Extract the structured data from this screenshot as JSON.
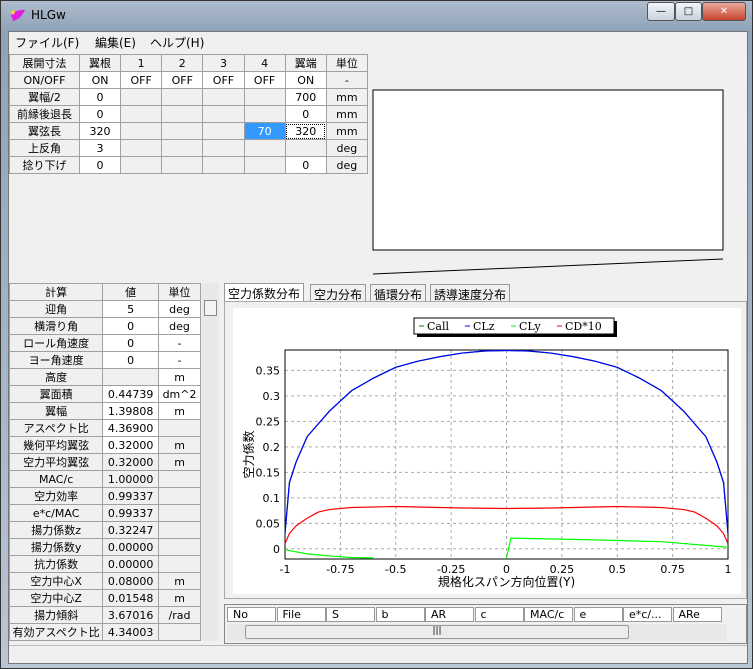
{
  "window": {
    "title": "HLGw",
    "minimize": "—",
    "maximize": "□",
    "close": "✕"
  },
  "menu": [
    "ファイル(F)",
    "編集(E)",
    "ヘルプ(H)"
  ],
  "dims_table": {
    "headers": [
      "展開寸法",
      "翼根",
      "1",
      "2",
      "3",
      "4",
      "翼端",
      "単位"
    ],
    "rows": [
      [
        "ON/OFF",
        "ON",
        "OFF",
        "OFF",
        "OFF",
        "OFF",
        "ON",
        "-"
      ],
      [
        "翼幅/2",
        "0",
        "",
        "",
        "",
        "",
        "700",
        "mm"
      ],
      [
        "前縁後退長",
        "0",
        "",
        "",
        "",
        "",
        "0",
        "mm"
      ],
      [
        "翼弦長",
        "320",
        "",
        "",
        "",
        "70",
        "320",
        "mm"
      ],
      [
        "上反角",
        "3",
        "",
        "",
        "",
        "",
        "",
        "deg"
      ],
      [
        "捻り下げ",
        "0",
        "",
        "",
        "",
        "",
        "0",
        "deg"
      ]
    ]
  },
  "calc_table": {
    "headers": [
      "計算",
      "値",
      "単位"
    ],
    "rows": [
      [
        "迎角",
        "5",
        "deg"
      ],
      [
        "横滑り角",
        "0",
        "deg"
      ],
      [
        "ロール角速度",
        "0",
        "-"
      ],
      [
        "ヨー角速度",
        "0",
        "-"
      ],
      [
        "高度",
        "",
        "m"
      ],
      [
        "翼面積",
        "0.44739",
        "dm^2"
      ],
      [
        "翼幅",
        "1.39808",
        "m"
      ],
      [
        "アスペクト比",
        "4.36900",
        ""
      ],
      [
        "幾何平均翼弦",
        "0.32000",
        "m"
      ],
      [
        "空力平均翼弦",
        "0.32000",
        "m"
      ],
      [
        "MAC/c",
        "1.00000",
        ""
      ],
      [
        "空力効率",
        "0.99337",
        ""
      ],
      [
        "e*c/MAC",
        "0.99337",
        ""
      ],
      [
        "揚力係数z",
        "0.32247",
        ""
      ],
      [
        "揚力係数y",
        "0.00000",
        ""
      ],
      [
        "抗力係数",
        "0.00000",
        ""
      ],
      [
        "空力中心X",
        "0.08000",
        "m"
      ],
      [
        "空力中心Z",
        "0.01548",
        "m"
      ],
      [
        "揚力傾斜",
        "3.67016",
        "/rad"
      ],
      [
        "有効アスペクト比",
        "4.34003",
        ""
      ]
    ]
  },
  "tabs": [
    {
      "label": "空力係数分布",
      "active": true
    },
    {
      "label": "空力分布"
    },
    {
      "label": "循環分布"
    },
    {
      "label": "誘導速度分布"
    }
  ],
  "list_headers": [
    "No",
    "File",
    "S",
    "b",
    "AR",
    "c",
    "MAC/c",
    "e",
    "e*c/...",
    "ARe"
  ],
  "chart_data": {
    "type": "line",
    "xlabel": "規格化スパン方向位置(Y)",
    "ylabel": "空力係数",
    "xlim": [
      -1,
      1
    ],
    "ylim": [
      -0.02,
      0.39
    ],
    "xticks": [
      "-1",
      "-0.75",
      "-0.5",
      "-0.25",
      "0",
      "0.25",
      "0.5",
      "0.75",
      "1"
    ],
    "yticks": [
      "0",
      "0.05",
      "0.1",
      "0.15",
      "0.2",
      "0.25",
      "0.3",
      "0.35"
    ],
    "grid": true,
    "legend_position": "top",
    "series": [
      {
        "name": "Call",
        "color": "#008000",
        "x": [
          -1,
          -0.98,
          -0.95,
          -0.9,
          -0.8,
          -0.7,
          -0.6,
          -0.5,
          -0.4,
          -0.3,
          -0.2,
          -0.1,
          0,
          0.1,
          0.2,
          0.3,
          0.4,
          0.5,
          0.6,
          0.7,
          0.8,
          0.9,
          0.95,
          0.98,
          1
        ],
        "y": [
          0.03,
          0.13,
          0.17,
          0.22,
          0.27,
          0.31,
          0.335,
          0.356,
          0.368,
          0.377,
          0.384,
          0.388,
          0.389,
          0.388,
          0.384,
          0.377,
          0.368,
          0.356,
          0.335,
          0.31,
          0.27,
          0.22,
          0.17,
          0.13,
          0.03
        ]
      },
      {
        "name": "CLz",
        "color": "#0000ff",
        "x": [
          -1,
          -0.98,
          -0.95,
          -0.9,
          -0.8,
          -0.7,
          -0.6,
          -0.5,
          -0.4,
          -0.3,
          -0.2,
          -0.1,
          0,
          0.1,
          0.2,
          0.3,
          0.4,
          0.5,
          0.6,
          0.7,
          0.8,
          0.9,
          0.95,
          0.98,
          1
        ],
        "y": [
          0.03,
          0.13,
          0.17,
          0.22,
          0.27,
          0.31,
          0.335,
          0.356,
          0.368,
          0.377,
          0.384,
          0.388,
          0.389,
          0.388,
          0.384,
          0.377,
          0.368,
          0.356,
          0.335,
          0.31,
          0.27,
          0.22,
          0.17,
          0.13,
          0.03
        ]
      },
      {
        "name": "CLy",
        "color": "#00ff00",
        "segments": [
          {
            "x": [
              -1,
              -0.9,
              -0.8,
              -0.7,
              -0.6
            ],
            "y": [
              -0.002,
              -0.01,
              -0.014,
              -0.017,
              -0.018
            ]
          },
          {
            "x": [
              0,
              0.02,
              0.35,
              0.7,
              1
            ],
            "y": [
              -0.018,
              0.021,
              0.018,
              0.014,
              0.003
            ]
          }
        ]
      },
      {
        "name": "CD*10",
        "color": "#ff0000",
        "x": [
          -1,
          -0.98,
          -0.95,
          -0.9,
          -0.85,
          -0.8,
          -0.7,
          -0.5,
          -0.2,
          0,
          0.2,
          0.5,
          0.7,
          0.8,
          0.85,
          0.9,
          0.95,
          0.98,
          1
        ],
        "y": [
          0.01,
          0.03,
          0.045,
          0.06,
          0.072,
          0.077,
          0.081,
          0.083,
          0.08,
          0.079,
          0.08,
          0.083,
          0.081,
          0.077,
          0.072,
          0.06,
          0.045,
          0.03,
          0.01
        ]
      }
    ]
  }
}
